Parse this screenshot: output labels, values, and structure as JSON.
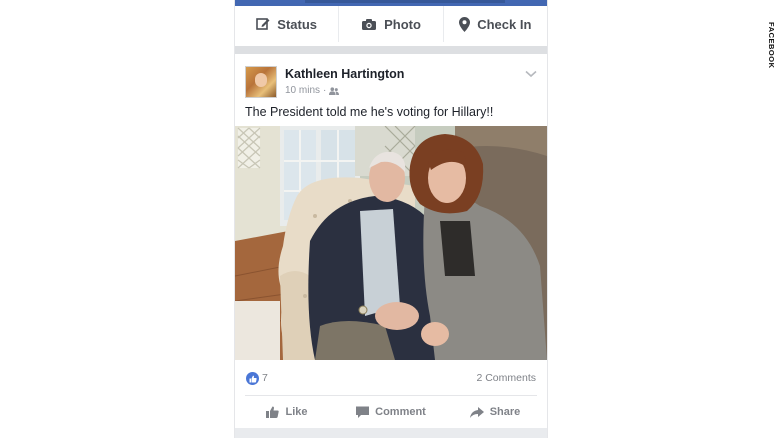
{
  "composer": {
    "status_label": "Status",
    "photo_label": "Photo",
    "checkin_label": "Check In"
  },
  "post": {
    "author": "Kathleen Hartington",
    "time": "10 mins",
    "privacy_icon": "friends-icon",
    "text": "The President told me he's voting for Hillary!!",
    "likes_count": "7",
    "comments_count": "2 Comments",
    "actions": {
      "like_label": "Like",
      "comment_label": "Comment",
      "share_label": "Share"
    }
  },
  "watermark": "FACEBOOK",
  "colors": {
    "brand_blue": "#4267b2",
    "like_blue": "#4a76d6",
    "text_gray": "#90949c"
  }
}
